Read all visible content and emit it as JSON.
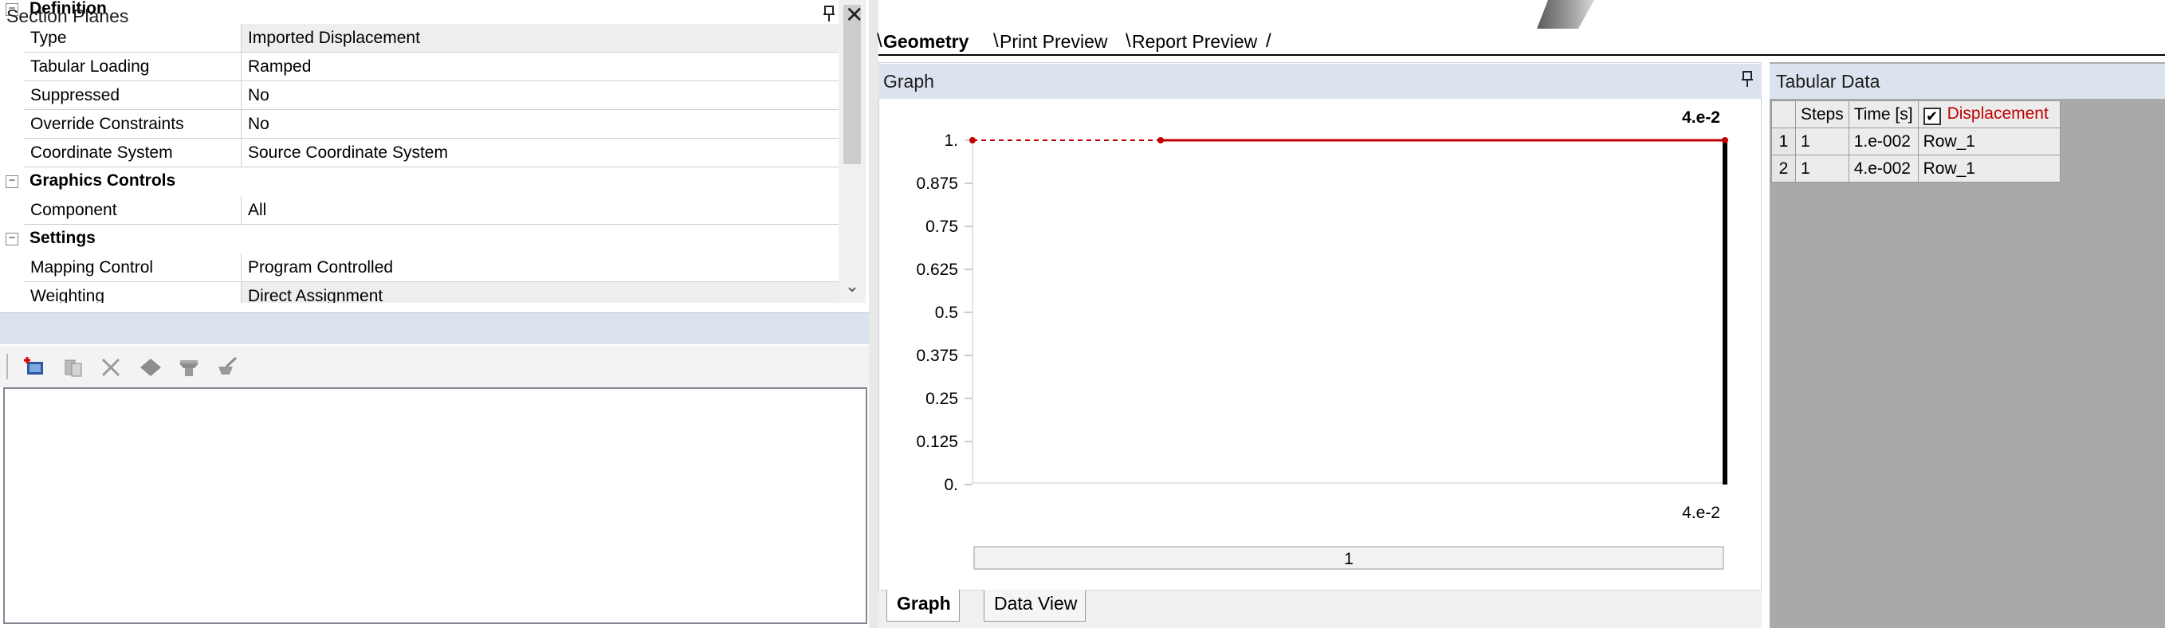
{
  "details": {
    "rows": [
      {
        "kind": "category",
        "label": "Definition"
      },
      {
        "kind": "prop",
        "key": "Type",
        "value": "Imported Displacement",
        "shaded": true
      },
      {
        "kind": "prop",
        "key": "Tabular Loading",
        "value": "Ramped",
        "shaded": false
      },
      {
        "kind": "prop",
        "key": "Suppressed",
        "value": "No",
        "shaded": false
      },
      {
        "kind": "prop",
        "key": "Override Constraints",
        "value": "No",
        "shaded": false
      },
      {
        "kind": "prop",
        "key": "Coordinate System",
        "value": "Source Coordinate System",
        "shaded": false
      },
      {
        "kind": "category",
        "label": "Graphics Controls"
      },
      {
        "kind": "prop",
        "key": "Component",
        "value": "All",
        "shaded": false
      },
      {
        "kind": "category",
        "label": "Settings"
      },
      {
        "kind": "prop",
        "key": "Mapping Control",
        "value": "Program Controlled",
        "shaded": false
      },
      {
        "kind": "prop",
        "key": "Weighting",
        "value": "Direct Assignment",
        "shaded": true
      }
    ],
    "collapse_glyph": "−"
  },
  "section_planes": {
    "title": "Section Planes",
    "pin_icon": "pin-icon",
    "close_glyph": "✕",
    "toolbar": [
      "new-section-plane-icon",
      "copy-icon",
      "delete-icon",
      "show-plane-icon",
      "show-whole-elements-icon",
      "edit-icon"
    ]
  },
  "view_tabs": [
    {
      "label": "Geometry",
      "active": true
    },
    {
      "label": "Print Preview",
      "active": false
    },
    {
      "label": "Report Preview",
      "active": false
    }
  ],
  "graph_panel": {
    "title": "Graph",
    "top_time_label": "4.e-2",
    "bottom_time_label": "4.e-2",
    "step_bar_label": "1",
    "bottom_tabs": [
      {
        "label": "Graph",
        "active": true
      },
      {
        "label": "Data View",
        "active": false
      }
    ]
  },
  "chart_data": {
    "type": "line",
    "x": [
      0,
      0.01,
      0.04
    ],
    "y": [
      1,
      1,
      1
    ],
    "x_range": [
      0,
      0.04
    ],
    "ylim": [
      0,
      1
    ],
    "y_ticks": [
      "1.",
      "0.875",
      "0.75",
      "0.625",
      "0.5",
      "0.375",
      "0.25",
      "0.125",
      "0."
    ],
    "y_tick_values": [
      1,
      0.875,
      0.75,
      0.625,
      0.5,
      0.375,
      0.25,
      0.125,
      0
    ],
    "dashed_until_x": 0.01,
    "current_time_marker_x": 0.04,
    "line_color": "#c00000",
    "marker_color": "#000000"
  },
  "tabular_data": {
    "title": "Tabular Data",
    "columns": [
      "Steps",
      "Time [s]",
      "Displacement"
    ],
    "displacement_checked": true,
    "rows": [
      {
        "index": "1",
        "steps": "1",
        "time": "1.e-002",
        "displacement": "Row_1"
      },
      {
        "index": "2",
        "steps": "1",
        "time": "4.e-002",
        "displacement": "Row_1"
      }
    ]
  }
}
